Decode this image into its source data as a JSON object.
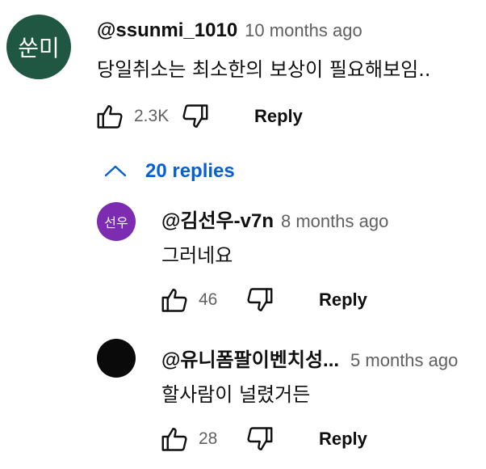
{
  "colors": {
    "main_avatar_bg": "#1f5743",
    "reply1_avatar_bg": "#7d2bb0",
    "reply2_avatar_bg": "#0a0a0a",
    "link_blue": "#065fd4",
    "secondary_text": "#606060"
  },
  "comment": {
    "avatar_text": "쑨미",
    "author": "@ssunmi_1010",
    "time": "10 months ago",
    "text": "당일취소는 최소한의 보상이 필요해보임..",
    "like_count": "2.3K",
    "reply_label": "Reply"
  },
  "replies_toggle": {
    "icon": "chevron-up-icon",
    "label": "20 replies"
  },
  "replies": [
    {
      "avatar_text": "선우",
      "author": "@김선우-v7n",
      "time": "8 months ago",
      "text": "그러네요",
      "like_count": "46",
      "reply_label": "Reply"
    },
    {
      "avatar_text": "",
      "author": "@유니폼팔이벤치성...",
      "time": "5 months ago",
      "text": "할사람이 널렸거든",
      "like_count": "28",
      "reply_label": "Reply"
    }
  ],
  "icons": {
    "like": "thumbs-up-icon",
    "dislike": "thumbs-down-icon"
  }
}
